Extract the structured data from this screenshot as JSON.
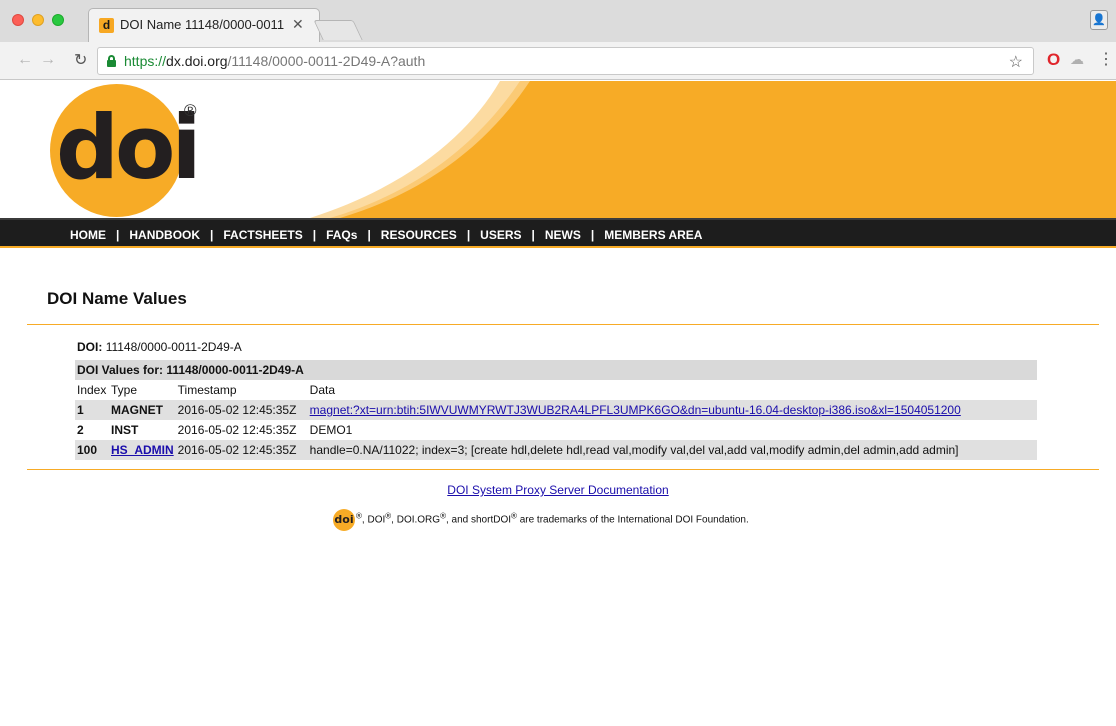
{
  "browser": {
    "tab_title": "DOI Name 11148/0000-0011",
    "tab_favicon": "d",
    "url_scheme": "https://",
    "url_host": "dx.doi.org",
    "url_path": "/11148/0000-0011-2D49-A?auth"
  },
  "logo": {
    "text": "doi",
    "registered": "®"
  },
  "nav": {
    "items": [
      "HOME",
      "HANDBOOK",
      "FACTSHEETS",
      "FAQs",
      "RESOURCES",
      "USERS",
      "NEWS",
      "MEMBERS AREA"
    ],
    "separator": "|"
  },
  "page_title": "DOI Name Values",
  "doi_label": "DOI:",
  "doi_value": "11148/0000-0011-2D49-A",
  "values_header": "DOI Values for: 11148/0000-0011-2D49-A",
  "columns": [
    "Index",
    "Type",
    "Timestamp",
    "Data"
  ],
  "rows": [
    {
      "index": "1",
      "type": "MAGNET",
      "timestamp": "2016-05-02 12:45:35Z",
      "data": "magnet:?xt=urn:btih:5IWVUWMYRWTJ3WUB2RA4LPFL3UMPK6GO&dn=ubuntu-16.04-desktop-i386.iso&xl=1504051200"
    },
    {
      "index": "2",
      "type": "INST",
      "timestamp": "2016-05-02 12:45:35Z",
      "data": "DEMO1"
    },
    {
      "index": "100",
      "type": "HS_ADMIN",
      "timestamp": "2016-05-02 12:45:35Z",
      "data": "handle=0.NA/11022; index=3; [create hdl,delete hdl,read val,modify val,del val,add val,modify admin,del admin,add admin]"
    }
  ],
  "footer": {
    "doc_link": "DOI System Proxy Server Documentation",
    "tm_logo": "doi",
    "tm_doi": "DOI",
    "tm_doiorg": "DOI.ORG",
    "tm_shortdoi": "shortDOI",
    "tm_reg": "®",
    "tm_and": ", and",
    "tm_tail": "are trademarks of the International DOI Foundation."
  },
  "colors": {
    "brand_orange": "#f7ab26",
    "nav_bg": "#1d1d1d",
    "link": "#1a0dab"
  }
}
